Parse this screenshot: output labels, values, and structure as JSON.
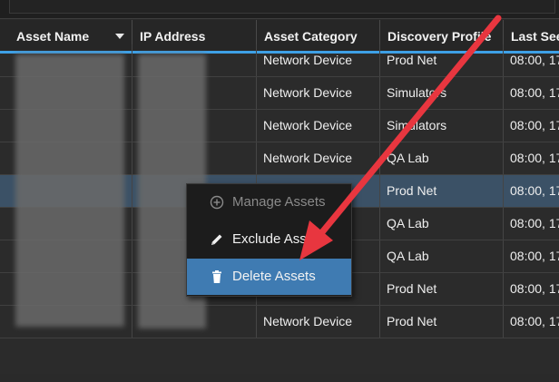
{
  "columns": [
    "Asset Name",
    "IP Address",
    "Asset Category",
    "Discovery Profile",
    "Last Seen"
  ],
  "rows": [
    {
      "category": "Network Device",
      "profile": "Prod Net",
      "last_seen": "08:00, 17"
    },
    {
      "category": "Network Device",
      "profile": "Simulators",
      "last_seen": "08:00, 17"
    },
    {
      "category": "Network Device",
      "profile": "Simulators",
      "last_seen": "08:00, 17"
    },
    {
      "category": "Network Device",
      "profile": "QA Lab",
      "last_seen": "08:00, 17"
    },
    {
      "category": "",
      "profile": "Prod Net",
      "last_seen": "08:00, 17"
    },
    {
      "category": "",
      "profile": "QA Lab",
      "last_seen": "08:00, 17"
    },
    {
      "category": "",
      "profile": "QA Lab",
      "last_seen": "08:00, 17"
    },
    {
      "category": "",
      "profile": "Prod Net",
      "last_seen": "08:00, 17"
    },
    {
      "category": "Network Device",
      "profile": "Prod Net",
      "last_seen": "08:00, 17"
    }
  ],
  "context_menu": {
    "items": [
      {
        "label": "Manage Assets",
        "icon": "plus-circle-icon",
        "state": "disabled"
      },
      {
        "label": "Exclude Assets",
        "icon": "pencil-icon",
        "state": "normal"
      },
      {
        "label": "Delete Assets",
        "icon": "trash-icon",
        "state": "highlighted"
      }
    ]
  },
  "colors": {
    "accent": "#3ea0e6",
    "selected_row": "#3b5166",
    "menu_highlight": "#3f7bb2",
    "annotation_arrow": "#e8363f"
  }
}
